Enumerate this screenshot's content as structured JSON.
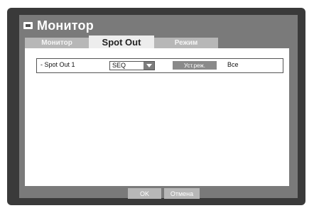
{
  "window": {
    "title": "Монитор",
    "icon": "monitor-icon"
  },
  "tabs": [
    {
      "label": "Монитор",
      "active": false
    },
    {
      "label": "Spot Out",
      "active": true
    },
    {
      "label": "Режим",
      "active": false
    }
  ],
  "spot_out": {
    "label": "- Spot Out 1",
    "select_value": "SEQ",
    "setup_label": "Уст.реж.",
    "setup_value": "Все"
  },
  "footer": {
    "ok_label": "OK",
    "cancel_label": "Отмена"
  }
}
